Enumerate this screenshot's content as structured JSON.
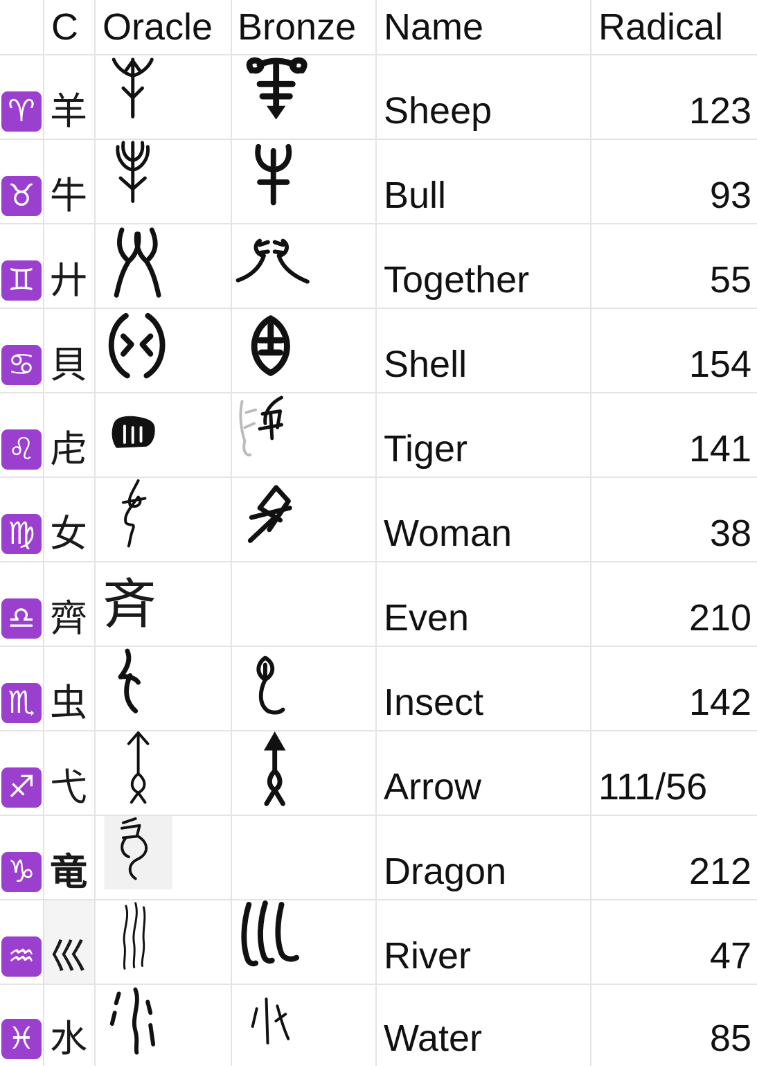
{
  "header": {
    "c": "C",
    "oracle": "Oracle",
    "bronze": "Bronze",
    "name": "Name",
    "radical": "Radical"
  },
  "rows": [
    {
      "zodiac": "♈",
      "zodiac_icon": "aries-icon",
      "char": "羊",
      "name": "Sheep",
      "radical": "123"
    },
    {
      "zodiac": "♉",
      "zodiac_icon": "taurus-icon",
      "char": "牛",
      "name": "Bull",
      "radical": "93"
    },
    {
      "zodiac": "♊",
      "zodiac_icon": "gemini-icon",
      "char": "廾",
      "name": "Together",
      "radical": "55"
    },
    {
      "zodiac": "♋",
      "zodiac_icon": "cancer-icon",
      "char": "貝",
      "name": "Shell",
      "radical": "154"
    },
    {
      "zodiac": "♌",
      "zodiac_icon": "leo-icon",
      "char": "虍",
      "name": "Tiger",
      "radical": "141"
    },
    {
      "zodiac": "♍",
      "zodiac_icon": "virgo-icon",
      "char": "女",
      "name": "Woman",
      "radical": "38"
    },
    {
      "zodiac": "♎",
      "zodiac_icon": "libra-icon",
      "char": "齊",
      "oracle_char": "斉",
      "name": "Even",
      "radical": "210"
    },
    {
      "zodiac": "♏",
      "zodiac_icon": "scorpio-icon",
      "char": "虫",
      "name": "Insect",
      "radical": "142"
    },
    {
      "zodiac": "♐",
      "zodiac_icon": "sagittarius-icon",
      "char": "弋",
      "name": "Arrow",
      "radical": "111/56"
    },
    {
      "zodiac": "♑",
      "zodiac_icon": "capricorn-icon",
      "char": "竜",
      "name": "Dragon",
      "radical": "212"
    },
    {
      "zodiac": "♒",
      "zodiac_icon": "aquarius-icon",
      "char": "巛",
      "name": "River",
      "radical": "47"
    },
    {
      "zodiac": "♓",
      "zodiac_icon": "pisces-icon",
      "char": "水",
      "name": "Water",
      "radical": "85"
    }
  ]
}
